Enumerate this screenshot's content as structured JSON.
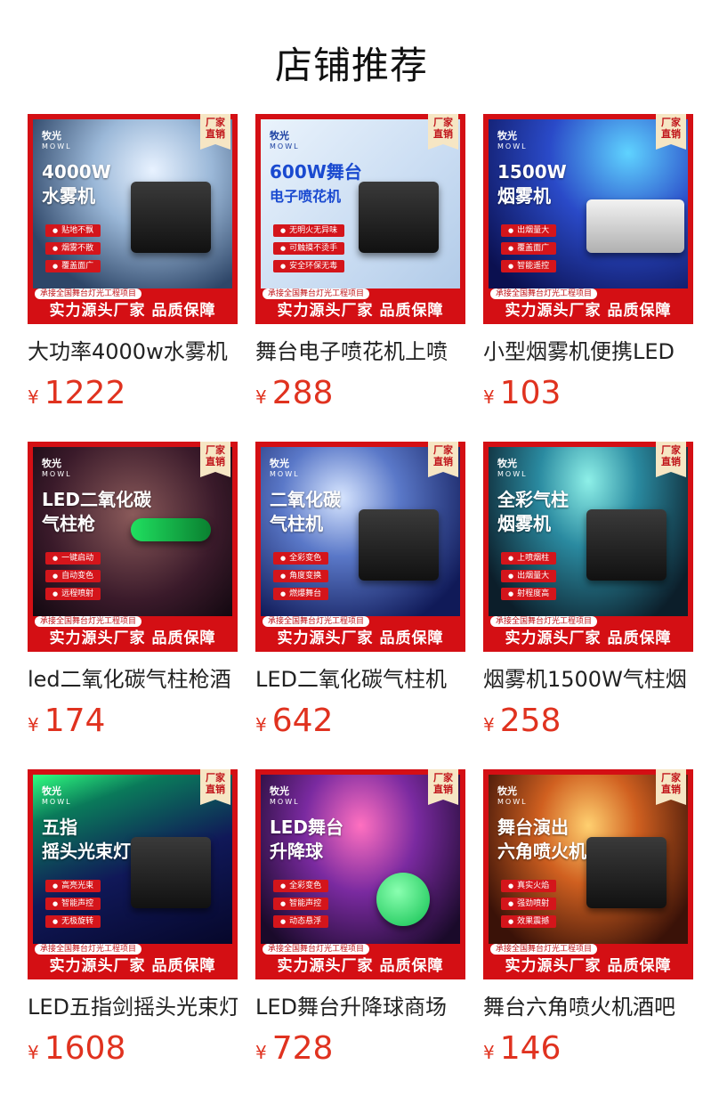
{
  "page_title": "店铺推荐",
  "common": {
    "badge_line1": "厂家",
    "badge_line2": "直销",
    "brand_cn": "牧光",
    "brand_en": "MOWL",
    "tagline": "承接全国舞台灯光工程项目",
    "banner": "实力源头厂家 品质保障",
    "currency": "¥"
  },
  "products": [
    {
      "name": "大功率4000w水雾机",
      "price": "1222",
      "headline1": "4000W",
      "headline2": "水雾机",
      "features": [
        "贴地不飘",
        "烟雾不散",
        "覆盖面广"
      ],
      "bg": "#4b6a8c"
    },
    {
      "name": "舞台电子喷花机上喷",
      "price": "288",
      "headline1": "600W舞台",
      "headline2": "电子喷花机",
      "features": [
        "无明火无异味",
        "可触摸不烫手",
        "安全环保无毒"
      ],
      "bg": "#cfe0f2"
    },
    {
      "name": "小型烟雾机便携LED",
      "price": "103",
      "headline1": "1500W",
      "headline2": "烟雾机",
      "features": [
        "出烟量大",
        "覆盖面广",
        "智能遥控"
      ],
      "bg": "#14206e"
    },
    {
      "name": "led二氧化碳气柱枪酒",
      "price": "174",
      "headline1": "LED二氧化碳",
      "headline2": "气柱枪",
      "features": [
        "一键启动",
        "自动变色",
        "远程喷射"
      ],
      "bg": "#3a2a2a"
    },
    {
      "name": "LED二氧化碳气柱机",
      "price": "642",
      "headline1": "二氧化碳",
      "headline2": "气柱机",
      "features": [
        "全彩变色",
        "角度变换",
        "燃爆舞台"
      ],
      "bg": "#1f2f7a"
    },
    {
      "name": "烟雾机1500W气柱烟",
      "price": "258",
      "headline1": "全彩气柱",
      "headline2": "烟雾机",
      "features": [
        "上喷烟柱",
        "出烟量大",
        "射程度高"
      ],
      "bg": "#1c3a4a"
    },
    {
      "name": "LED五指剑摇头光束灯",
      "price": "1608",
      "headline1": "五指",
      "headline2": "摇头光束灯",
      "features": [
        "高亮光束",
        "智能声控",
        "无极旋转"
      ],
      "bg": "#0d0f3e"
    },
    {
      "name": "LED舞台升降球商场",
      "price": "728",
      "headline1": "LED舞台",
      "headline2": "升降球",
      "features": [
        "全彩变色",
        "智能声控",
        "动态悬浮"
      ],
      "bg": "#2a1740"
    },
    {
      "name": "舞台六角喷火机酒吧",
      "price": "146",
      "headline1": "舞台演出",
      "headline2": "六角喷火机",
      "features": [
        "真实火焰",
        "强劲喷射",
        "效果震撼"
      ],
      "bg": "#5a2710"
    }
  ]
}
